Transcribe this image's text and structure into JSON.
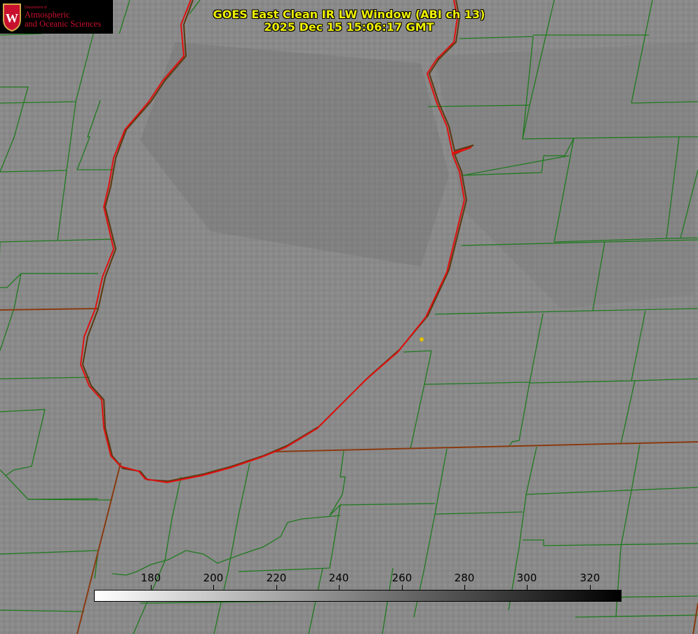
{
  "title": {
    "line1": "GOES East Clean IR LW Window (ABI ch 13)",
    "line2": "2025 Dec 15 15:06:17 GMT"
  },
  "logo": {
    "department": "Department of",
    "line1": "Atmospheric",
    "line2": "and Oceanic Sciences",
    "seal_letter": "W"
  },
  "colorbar": {
    "ticks": [
      "180",
      "200",
      "220",
      "240",
      "260",
      "280",
      "300",
      "320"
    ],
    "start_color": "#ffffff",
    "end_color": "#000000"
  },
  "colors": {
    "title": "#f0f000",
    "county_lines": "#1f7a1f",
    "lake_shoreline": "#e01010",
    "state_border": "#8a3a10",
    "marker": "#e0c000",
    "background": "#8a8a8a"
  }
}
